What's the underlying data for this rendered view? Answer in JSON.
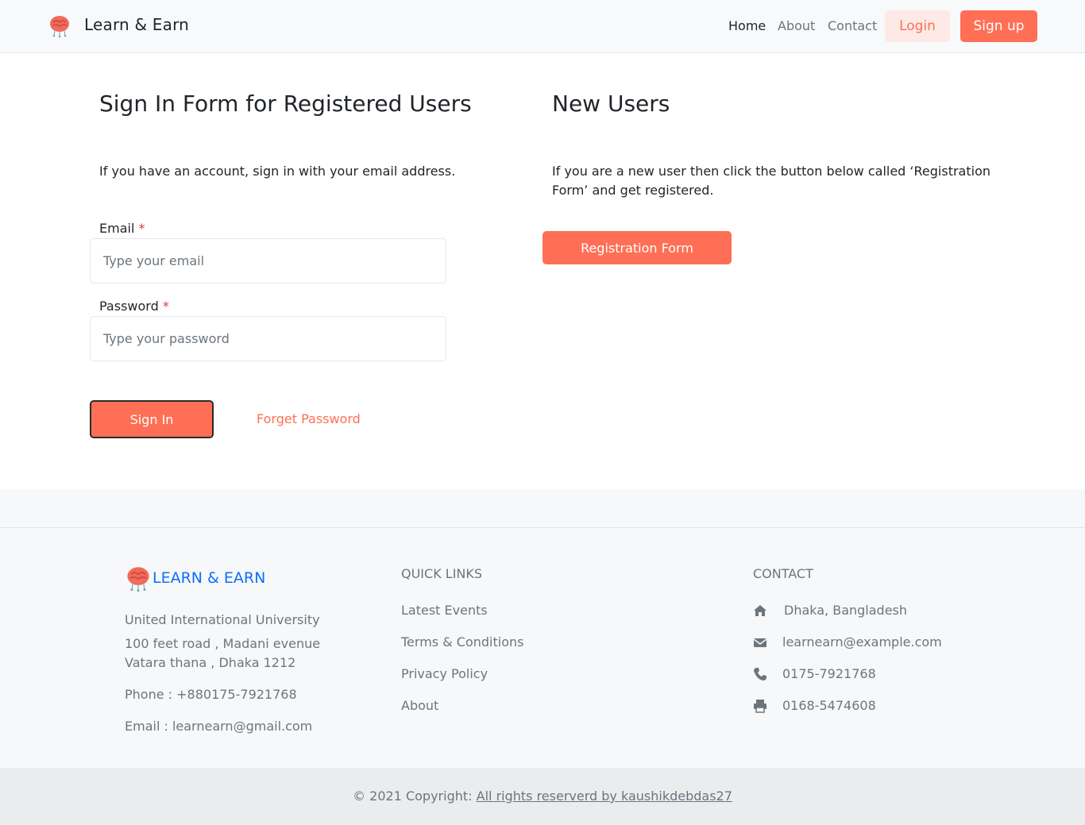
{
  "navbar": {
    "brand": "Learn & Earn",
    "links": [
      "Home",
      "About",
      "Contact"
    ],
    "login": "Login",
    "signup": "Sign up"
  },
  "signin": {
    "title": "Sign In Form for Registered Users",
    "description": "If you have an account, sign in with your email address.",
    "email_label": "Email",
    "email_placeholder": "Type your email",
    "password_label": "Password",
    "password_placeholder": "Type your password",
    "required_mark": "*",
    "submit": "Sign In",
    "forget": "Forget Password"
  },
  "newusers": {
    "title": "New Users",
    "description": "If you are a new user then click the button below called ‘Registration Form’ and get registered.",
    "button": "Registration Form"
  },
  "footer": {
    "brand": "LEARN & EARN",
    "address_line1": "United International University",
    "address_line2": "100 feet road , Madani evenue",
    "address_line3": "Vatara thana , Dhaka 1212",
    "phone": "Phone : +880175-7921768",
    "email": "Email : learnearn@gmail.com",
    "quick_links_title": "QUICK LINKS",
    "quick_links": [
      "Latest Events",
      "Terms & Conditions",
      "Privacy Policy",
      "About"
    ],
    "contact_title": "CONTACT",
    "contact": {
      "location": "Dhaka, Bangladesh",
      "email": "learnearn@example.com",
      "phone": "0175-7921768",
      "fax": "0168-5474608"
    },
    "copyright_prefix": "© 2021 Copyright:",
    "copyright_link": "All rights reserverd by kaushikdebdas27"
  },
  "colors": {
    "accent": "#ff6f55",
    "brand_blue": "#0d6efd"
  },
  "icons": [
    "brain-logo-icon",
    "home-icon",
    "envelope-icon",
    "phone-icon",
    "printer-icon"
  ]
}
